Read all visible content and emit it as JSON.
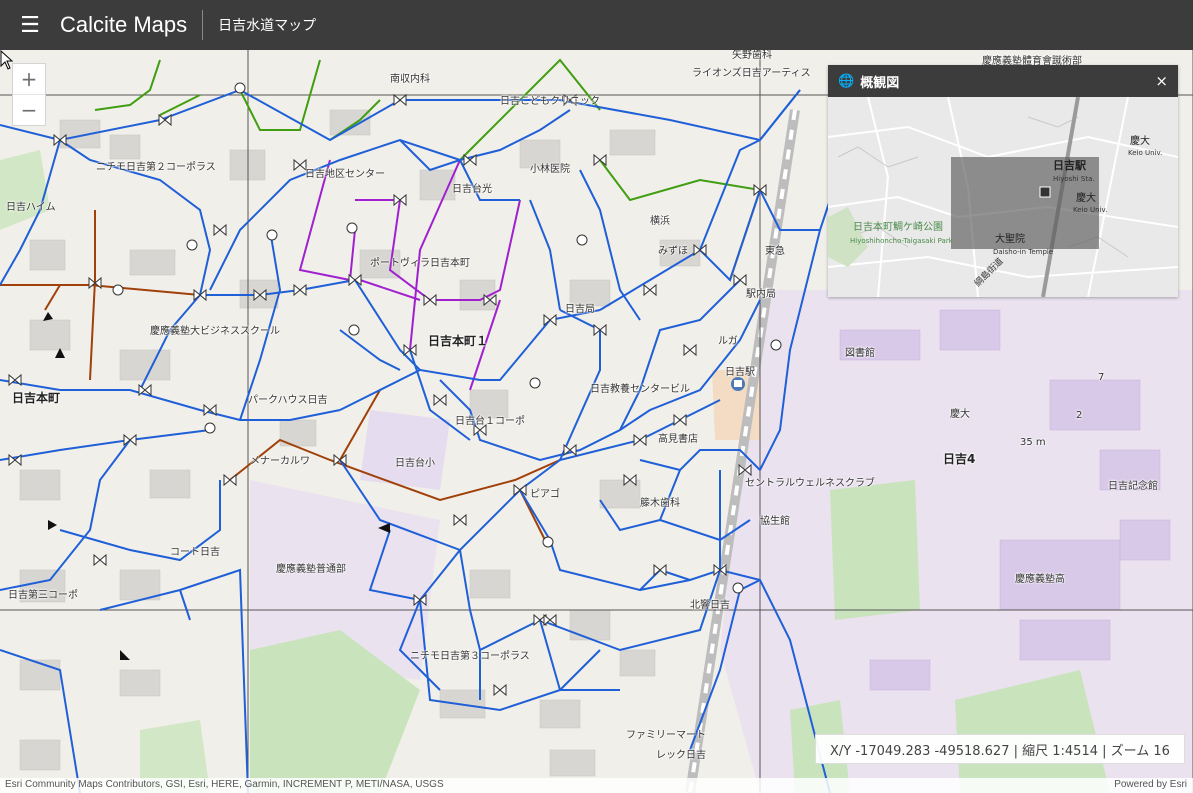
{
  "header": {
    "menu_icon": "hamburger-icon",
    "app_title": "Calcite Maps",
    "app_subtitle": "日吉水道マップ"
  },
  "zoom": {
    "in_label": "+",
    "out_label": "−"
  },
  "overview": {
    "title": "概観図",
    "close_label": "×",
    "labels": {
      "station_ja": "日吉駅",
      "station_en": "Hiyoshi Sta.",
      "keio_ja": "慶大",
      "keio_en": "Keio Univ.",
      "keio_top_ja": "慶大",
      "keio_top_en": "Keio Univ.",
      "park_ja": "日吉本町鯛ケ崎公園",
      "park_en": "Hiyoshihoncho-Taigasaki Park",
      "temple_ja": "大聖院",
      "temple_en": "Daisho-in Temple",
      "road": "綱島街道"
    }
  },
  "status": {
    "readout": "X/Y -17049.283 -49518.627 | 縮尺 1:4514 | ズーム 16"
  },
  "attribution": {
    "sources": "Esri Community Maps Contributors, GSI, Esri, HERE, Garmin, INCREMENT P, METI/NASA, USGS",
    "powered_by": "Powered by Esri"
  },
  "map_labels": {
    "nanshuu_naika": "南収内科",
    "yano_shika": "矢野歯科",
    "keio_gijuku_ikukai": "慶應義塾體育會蹴術部",
    "lions_hiyoshi": "ライオンズ日吉アーティス",
    "hiyoshi_kodomo": "日吉こどもクリニック",
    "nichimo_2": "ニチモ日吉第２コーポラス",
    "hiyoshi_chiku": "日吉地区センター",
    "kobayashi": "小林医院",
    "hiyoshi_daikou": "日吉台光",
    "hiyoshi_haimu": "日吉ハイム",
    "yokohama": "横浜",
    "mizuho": "みずほ",
    "toukyu": "東急",
    "eki_mae": "駅内局",
    "portvilla": "ポートヴィラ日吉本町",
    "hiyoshi_kyoku": "日吉局",
    "keio_business": "慶應義塾大ビジネススクール",
    "hiyoshi_honcho_1": "日吉本町１",
    "hiyoshi_honcho": "日吉本町",
    "parkhouse": "パークハウス日吉",
    "hiyoshi_kyouiku": "日吉教養センタービル",
    "hiyoshi_dai1": "日吉台１コーポ",
    "takami": "高見書店",
    "meinakaru": "メナーカルワ",
    "hiyoshidai_sho": "日吉台小",
    "piago": "ピアゴ",
    "kinoshita": "籐木歯科",
    "central_wellness": "セントラルウェルネスクラブ",
    "kyouseikan": "協生館",
    "court_hiyoshi": "コート日吉",
    "keio_futsubu": "慶應義塾普通部",
    "hiyoshi_dai3": "日吉第三コーポ",
    "kitachou": "北響日吉",
    "nichimo_3": "ニチモ日吉第３コーポラス",
    "familymart": "ファミリーマート",
    "lec": "レック日吉",
    "toshokan": "図書館",
    "keidai": "慶大",
    "hiyoshi_4": "日吉4",
    "hiyoshi_kinenkan": "日吉記念館",
    "keio_kou": "慶應義塾高",
    "contour_35": "35 m",
    "seven": "7",
    "two": "2",
    "hiyoshi_eki": "日吉駅",
    "aruga": "ルガ"
  },
  "colors": {
    "navbar": "#3c3c3c",
    "water_main": "#1f5fd8",
    "purple_line": "#a020d0",
    "brown_line": "#a0400a",
    "green_line": "#3f9e12",
    "grid_line": "#555555",
    "campus": "#ecdff0",
    "park": "#c7e2ba"
  }
}
